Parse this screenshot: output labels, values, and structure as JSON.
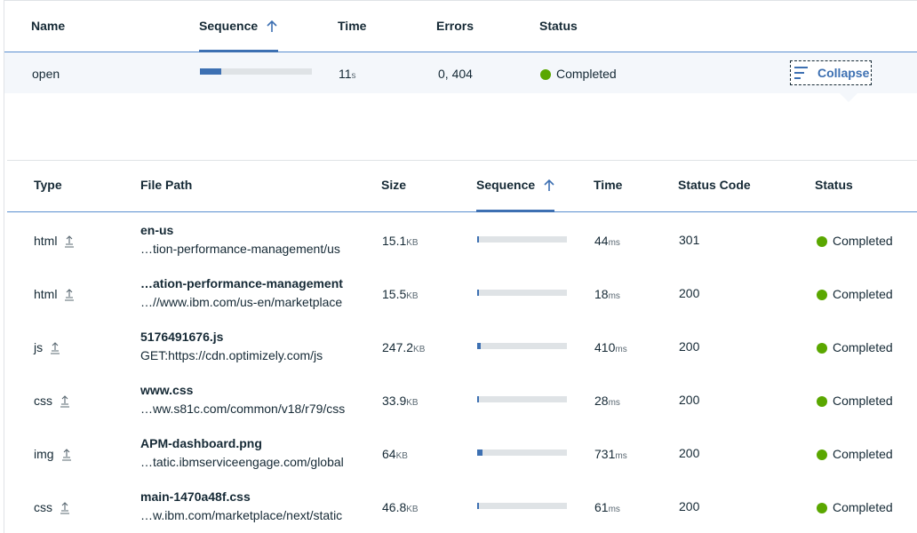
{
  "top_table": {
    "headers": {
      "name": "Name",
      "sequence": "Sequence",
      "time": "Time",
      "errors": "Errors",
      "status": "Status"
    },
    "row": {
      "name": "open",
      "sequence_progress": 0.19,
      "time_value": "11",
      "time_unit": "s",
      "errors": "0, 404",
      "status": "Completed",
      "collapse_label": "Collapse"
    }
  },
  "inner_table": {
    "headers": {
      "type": "Type",
      "file_path": "File Path",
      "size": "Size",
      "sequence": "Sequence",
      "time": "Time",
      "status_code": "Status Code",
      "status": "Status"
    },
    "rows": [
      {
        "type": "html",
        "path_main": "en-us",
        "path_sub": "…tion-performance-management/us",
        "size": "15.1",
        "size_unit": "KB",
        "sequence_progress": 0.02,
        "time": "44",
        "time_unit": "ms",
        "status_code": "301",
        "status": "Completed"
      },
      {
        "type": "html",
        "path_main": "…ation-performance-management",
        "path_sub": "…//www.ibm.com/us-en/marketplace",
        "size": "15.5",
        "size_unit": "KB",
        "sequence_progress": 0.02,
        "time": "18",
        "time_unit": "ms",
        "status_code": "200",
        "status": "Completed"
      },
      {
        "type": "js",
        "path_main": "5176491676.js",
        "path_sub": "GET:https://cdn.optimizely.com/js",
        "size": "247.2",
        "size_unit": "KB",
        "sequence_progress": 0.04,
        "time": "410",
        "time_unit": "ms",
        "status_code": "200",
        "status": "Completed"
      },
      {
        "type": "css",
        "path_main": "www.css",
        "path_sub": "…ww.s81c.com/common/v18/r79/css",
        "size": "33.9",
        "size_unit": "KB",
        "sequence_progress": 0.02,
        "time": "28",
        "time_unit": "ms",
        "status_code": "200",
        "status": "Completed"
      },
      {
        "type": "img",
        "path_main": "APM-dashboard.png",
        "path_sub": "…tatic.ibmserviceengage.com/global",
        "size": "64",
        "size_unit": "KB",
        "sequence_progress": 0.06,
        "time": "731",
        "time_unit": "ms",
        "status_code": "200",
        "status": "Completed"
      },
      {
        "type": "css",
        "path_main": "main-1470a48f.css",
        "path_sub": "…w.ibm.com/marketplace/next/static",
        "size": "46.8",
        "size_unit": "KB",
        "sequence_progress": 0.02,
        "time": "61",
        "time_unit": "ms",
        "status_code": "200",
        "status": "Completed"
      }
    ]
  },
  "icons": {
    "sort": "arrow-up-icon",
    "collapse": "collapse-lines-icon",
    "type": "upload-icon",
    "status": "status-dot"
  },
  "colors": {
    "accent": "#3d70b2",
    "success": "#5aa700",
    "bar_track": "#dfe3e6",
    "row_highlight": "#f4f7fb"
  }
}
